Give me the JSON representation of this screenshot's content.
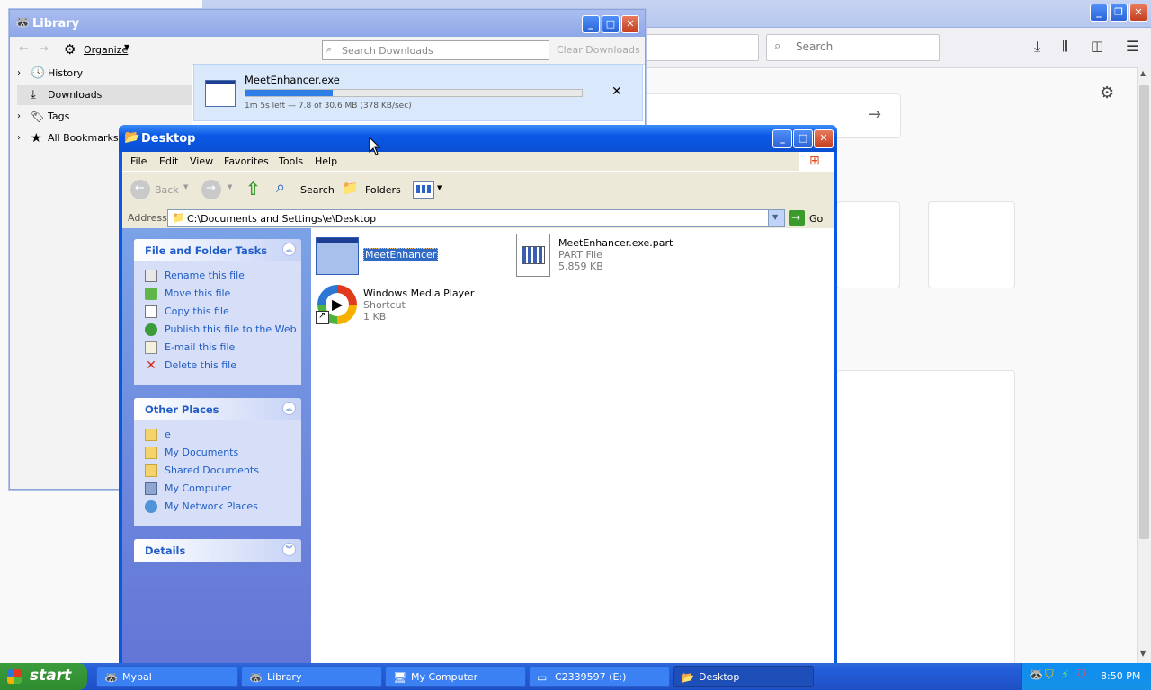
{
  "browser": {
    "search_placeholder": "Search",
    "arrow_icon": "arrow-right-icon"
  },
  "library": {
    "title": "Library",
    "organize_label": "Organize",
    "search_placeholder": "Search Downloads",
    "clear_label": "Clear Downloads",
    "tree": [
      {
        "label": "History"
      },
      {
        "label": "Downloads"
      },
      {
        "label": "Tags"
      },
      {
        "label": "All Bookmarks"
      }
    ],
    "download": {
      "filename": "MeetEnhancer.exe",
      "progress": 0.26,
      "status": "1m 5s left — 7.8 of 30.6 MB (378 KB/sec)"
    }
  },
  "explorer": {
    "title": "Desktop",
    "menu": [
      "File",
      "Edit",
      "View",
      "Favorites",
      "Tools",
      "Help"
    ],
    "toolbar": {
      "back": "Back",
      "search": "Search",
      "folders": "Folders"
    },
    "address_label": "Address",
    "address_value": "C:\\Documents and Settings\\e\\Desktop",
    "go_label": "Go",
    "file_tasks": {
      "title": "File and Folder Tasks",
      "items": [
        "Rename this file",
        "Move this file",
        "Copy this file",
        "Publish this file to the Web",
        "E-mail this file",
        "Delete this file"
      ]
    },
    "other_places": {
      "title": "Other Places",
      "items": [
        "e",
        "My Documents",
        "Shared Documents",
        "My Computer",
        "My Network Places"
      ]
    },
    "details": {
      "title": "Details"
    },
    "files": [
      {
        "name": "MeetEnhancer",
        "type": "",
        "size": ""
      },
      {
        "name": "MeetEnhancer.exe.part",
        "type": "PART File",
        "size": "5,859 KB"
      },
      {
        "name": "Windows Media Player",
        "type": "Shortcut",
        "size": "1 KB"
      }
    ]
  },
  "taskbar": {
    "start_label": "start",
    "buttons": [
      "Mypal",
      "Library",
      "My Computer",
      "C2339597 (E:)",
      "Desktop"
    ],
    "clock": "8:50 PM"
  },
  "colors": {
    "xp_blue": "#0a58e6",
    "task_blue": "#215dc6",
    "progress": "#2f7ee6"
  }
}
